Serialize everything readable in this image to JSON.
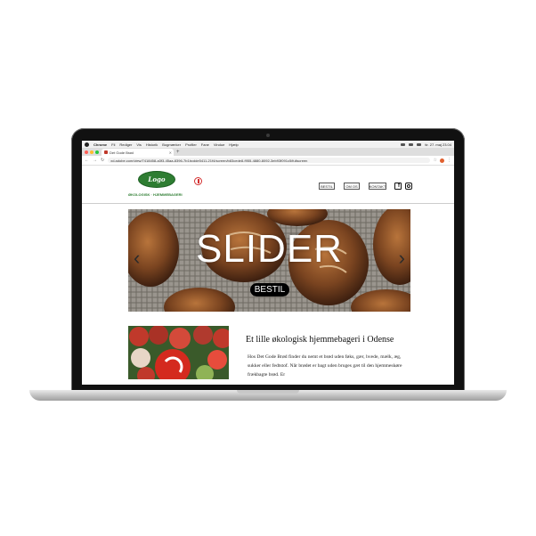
{
  "colors": {
    "brand_green": "#2e7d32",
    "accent_red": "#d32f2f",
    "cta_background": "#000000"
  },
  "mac_menubar": {
    "items": [
      "Chrome",
      "Fil",
      "Rediger",
      "Vis",
      "Historik",
      "Bogmærker",
      "Profiler",
      "Fane",
      "Vindue",
      "Hjælp"
    ],
    "clock": "tir. 27. maj 23.04"
  },
  "browser": {
    "tab_title": "Det Gode Brød",
    "url": "xd.adobe.com/view/7418458-a3f3-45aa-8396-7b1bcdde5411-21f4/screen/b83cede8-f955-4880-8092-3eb93f091c5/fullscreen",
    "icons": [
      "back-icon",
      "forward-icon",
      "reload-icon",
      "star-icon",
      "profile-icon",
      "kebab-icon"
    ]
  },
  "site": {
    "logo_text": "Logo",
    "tagline": "ØKOLOGISK · HJEMMEBAGERI",
    "nav": {
      "bestil": "BESTIL",
      "om_os": "OM OS",
      "kontakt": "KONTAKT"
    },
    "social": [
      "facebook-icon",
      "instagram-icon"
    ],
    "slider": {
      "title": "SLIDER",
      "cta": "BESTIL"
    },
    "intro": {
      "heading": "Et lille økologisk hjemmebageri i Odense",
      "body": "Hos Det Gode Brød finder du nemt et brød uden føks, gær, hvede, mælk, æg, sukker eller fedtstof. Når brødet er bagt uden bruges gæt til den hjemmeskøre frækbagte brød. Er"
    }
  }
}
